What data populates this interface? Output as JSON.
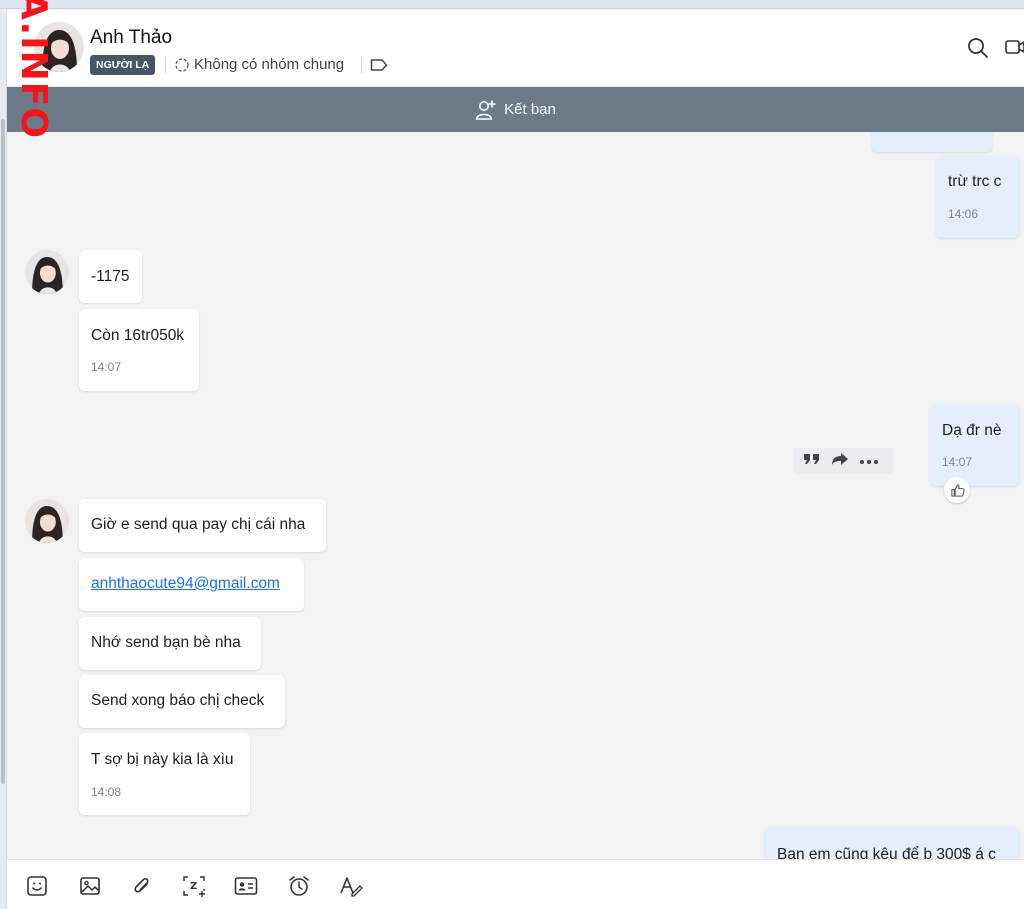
{
  "watermark": "A.INFO",
  "header": {
    "name": "Anh Thảo",
    "badge": "NGƯỜI LẠ",
    "groups": "Không có nhóm chung"
  },
  "friend_bar": {
    "label": "Kết bạn"
  },
  "messages": {
    "m1": {
      "text": "trừ trc c",
      "time": "14:06",
      "side": "me"
    },
    "m2": {
      "text": "-1175",
      "side": "them"
    },
    "m3": {
      "text": "Còn 16tr050k",
      "time": "14:07",
      "side": "them"
    },
    "m4": {
      "text": "Dạ đr nè",
      "time": "14:07",
      "side": "me"
    },
    "m5": {
      "text": "Giờ e send qua pay chị cái nha",
      "side": "them"
    },
    "m6": {
      "text": "anhthaocute94@gmail.com",
      "side": "them",
      "is_link": true
    },
    "m7": {
      "text": "Nhớ send bạn bè nha",
      "side": "them"
    },
    "m8": {
      "text": "Send xong báo chị check",
      "side": "them"
    },
    "m9": {
      "text": "T sợ bị này kia là xìu",
      "time": "14:08",
      "side": "them"
    },
    "m10": {
      "text": "Ban em cũng kêu để b 300$ á c",
      "side": "me"
    }
  },
  "icons": {
    "header": [
      "group-icon",
      "tag-icon",
      "search-icon",
      "video-call-icon"
    ],
    "friend_bar": "add-friend-icon",
    "hover_tools": [
      "quote-icon",
      "forward-icon",
      "more-icon"
    ],
    "reaction": "thumbs-up-icon",
    "toolbar": [
      "sticker-icon",
      "image-icon",
      "attachment-icon",
      "screenshot-icon",
      "contact-card-icon",
      "reminder-icon",
      "text-format-icon"
    ]
  },
  "colors": {
    "my_bubble": "#e5efff",
    "their_bubble": "#ffffff",
    "friend_bar": "#6d7a88",
    "badge": "#475569",
    "link": "#1a73e8",
    "watermark": "#f2151c"
  }
}
